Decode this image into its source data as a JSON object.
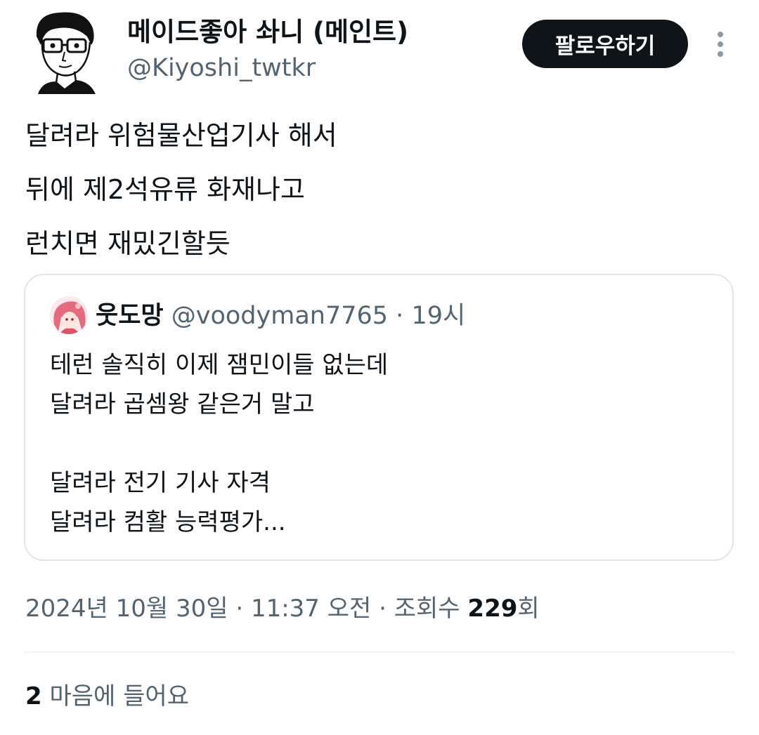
{
  "author": {
    "display_name": "메이드좋아 솨니 (메인트)",
    "handle": "@Kiyoshi_twtkr"
  },
  "actions": {
    "follow_label": "팔로우하기",
    "more_icon": "more-vertical-icon"
  },
  "tweet": {
    "lines": [
      "달려라 위험물산업기사 해서",
      "뒤에 제2석유류 화재나고",
      "런치면 재밌긴할듯"
    ]
  },
  "quote": {
    "name": "웃도망",
    "handle": "@voodyman7765",
    "separator": "·",
    "time": "19시",
    "lines": [
      "테런 솔직히 이제 잼민이들 없는데",
      "달려라 곱셈왕 같은거 말고",
      "",
      "달려라 전기 기사 자격",
      "달려라 컴활 능력평가..."
    ]
  },
  "meta": {
    "date": "2024년 10월 30일",
    "sep1": "·",
    "time": "11:37 오전",
    "sep2": "·",
    "views_label": "조회수",
    "views_count": "229",
    "views_suffix": "회"
  },
  "likes": {
    "count": "2",
    "label": "마음에 들어요"
  },
  "colors": {
    "text_primary": "#0f1419",
    "text_secondary": "#536471",
    "border": "#e1e6ea",
    "button_bg": "#0f1419"
  }
}
